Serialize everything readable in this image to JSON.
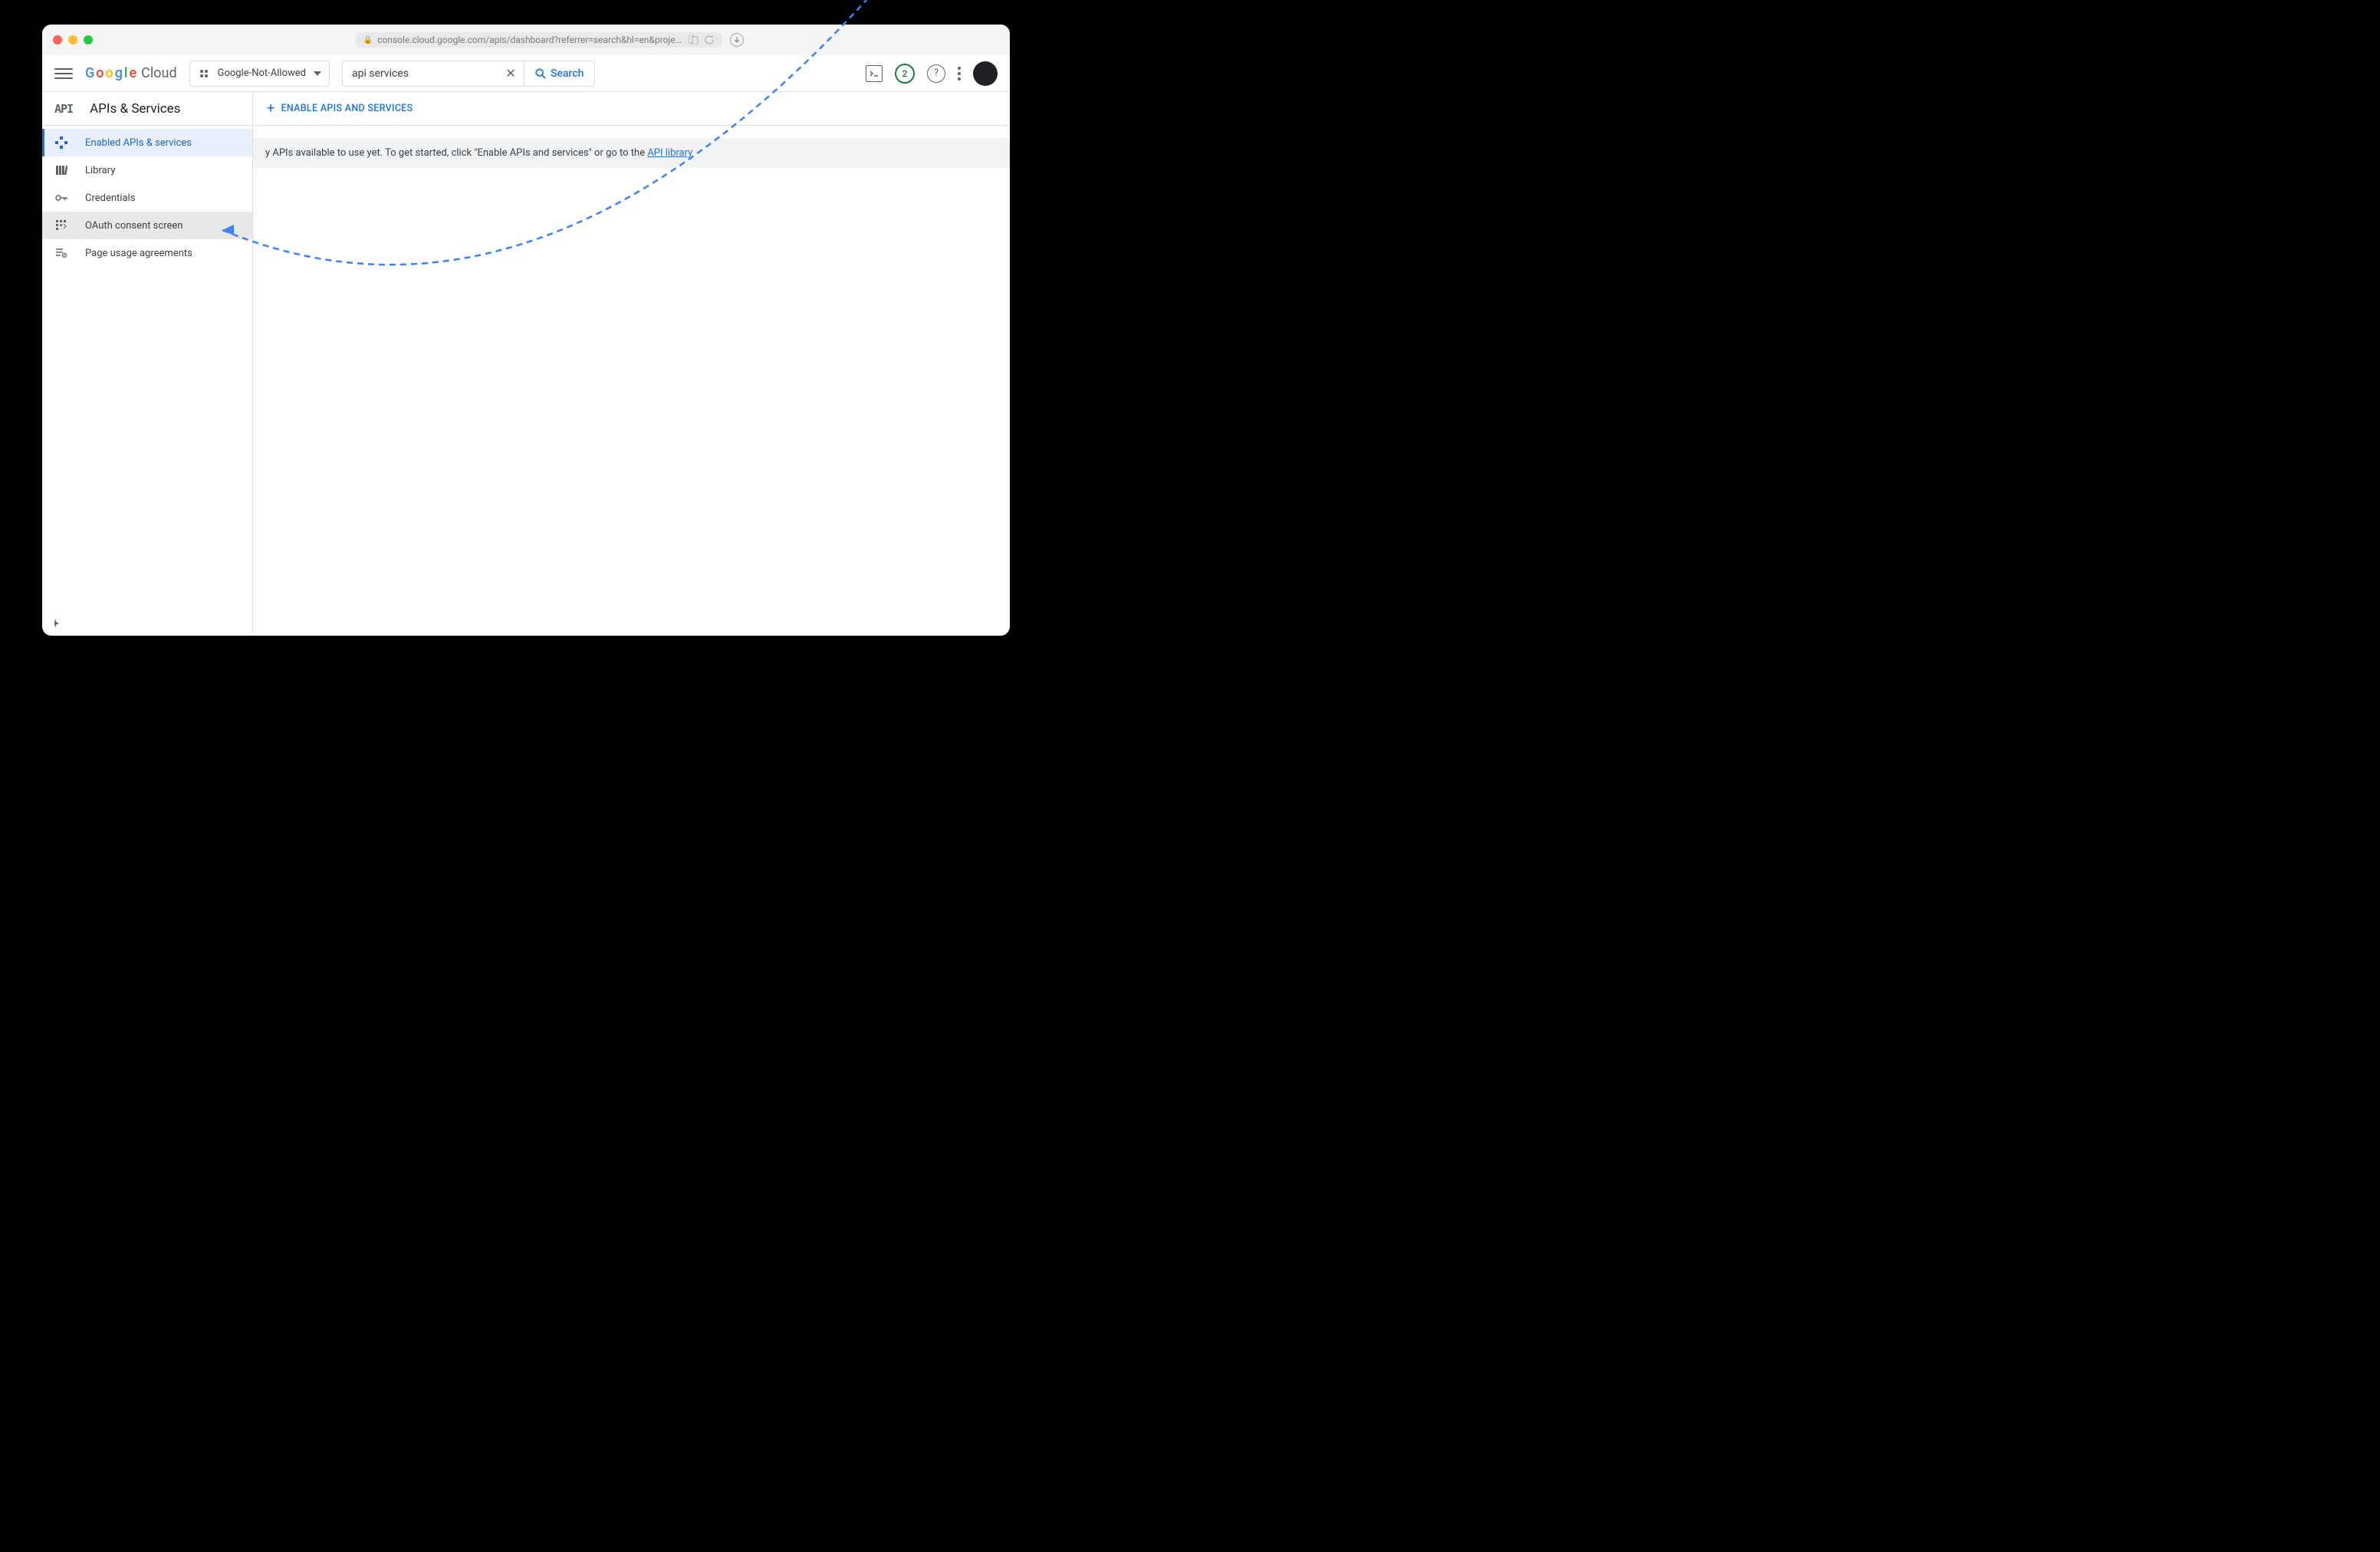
{
  "browser": {
    "url": "console.cloud.google.com/apis/dashboard?referrer=search&hl=en&project=ring"
  },
  "topbar": {
    "logo_cloud": "Cloud",
    "project_name": "Google-Not-Allowed",
    "search_value": "api services",
    "search_button": "Search",
    "badge_count": "2"
  },
  "sidebar": {
    "api_glyph": "API",
    "title": "APIs & Services",
    "items": [
      {
        "label": "Enabled APIs & services"
      },
      {
        "label": "Library"
      },
      {
        "label": "Credentials"
      },
      {
        "label": "OAuth consent screen"
      },
      {
        "label": "Page usage agreements"
      }
    ]
  },
  "main": {
    "enable_button": "ENABLE APIS AND SERVICES",
    "banner_text_prefix": "y APIs available to use yet. To get started, click \"Enable APIs and services\" or go to the ",
    "banner_link": "API library"
  }
}
